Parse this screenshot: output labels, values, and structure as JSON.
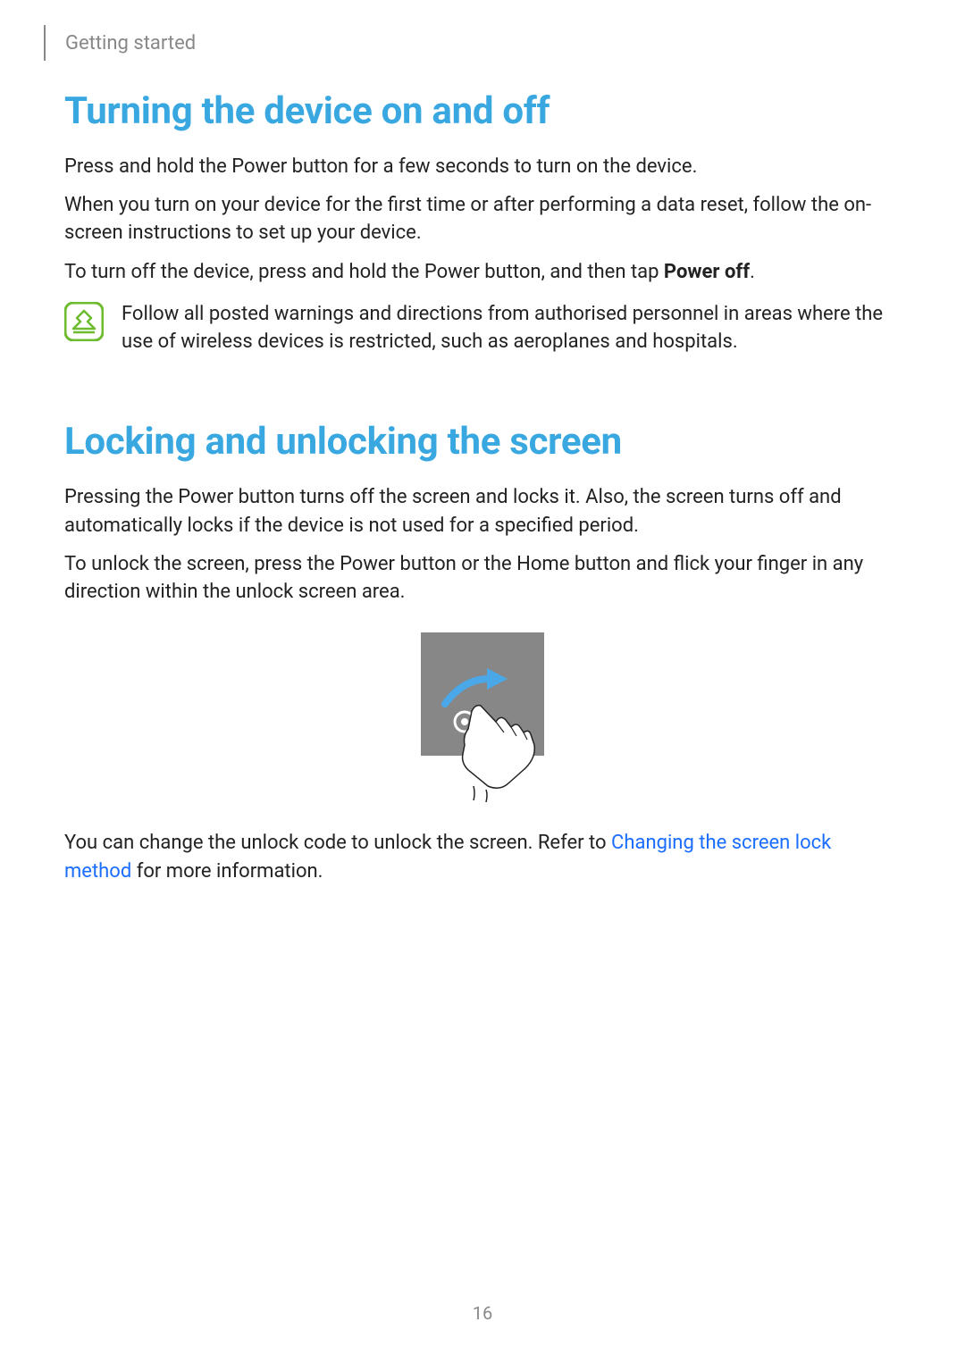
{
  "header": {
    "breadcrumb": "Getting started"
  },
  "section1": {
    "title": "Turning the device on and off",
    "p1": "Press and hold the Power button for a few seconds to turn on the device.",
    "p2": "When you turn on your device for the first time or after performing a data reset, follow the on-screen instructions to set up your device.",
    "p3_prefix": "To turn off the device, press and hold the Power button, and then tap ",
    "p3_bold": "Power off",
    "p3_suffix": ".",
    "note": "Follow all posted warnings and directions from authorised personnel in areas where the use of wireless devices is restricted, such as aeroplanes and hospitals."
  },
  "section2": {
    "title": "Locking and unlocking the screen",
    "p1": "Pressing the Power button turns off the screen and locks it. Also, the screen turns off and automatically locks if the device is not used for a specified period.",
    "p2": "To unlock the screen, press the Power button or the Home button and flick your finger in any direction within the unlock screen area.",
    "p3_prefix": "You can change the unlock code to unlock the screen. Refer to ",
    "p3_link": "Changing the screen lock method",
    "p3_suffix": " for more information."
  },
  "pageNumber": "16"
}
